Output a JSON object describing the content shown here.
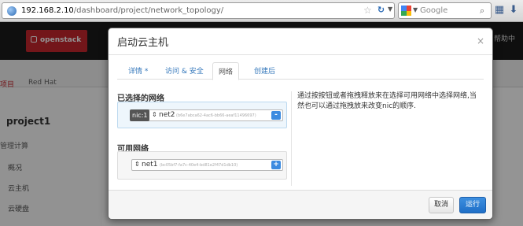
{
  "browser": {
    "url_host": "192.168.2.10",
    "url_path": "/dashboard/project/network_topology/",
    "search_placeholder": "Google"
  },
  "dashboard": {
    "logo_text": "openstack",
    "top_right": "帮助中",
    "tab_project": "项目",
    "tab_redhat": "Red Hat",
    "project_name": "project1",
    "section": "管理计算",
    "side_items": [
      "概况",
      "云主机",
      "云硬盘"
    ]
  },
  "modal": {
    "title": "启动云主机",
    "close": "×",
    "tabs": [
      "详情 *",
      "访问 & 安全",
      "网络",
      "创建后"
    ],
    "active_tab": "网络",
    "selected_title": "已选择的网络",
    "available_title": "可用网络",
    "selected_networks": [
      {
        "nic": "nic:1",
        "name": "net2",
        "id": "(b6e7abca62-4ac6-bb66-aeaf11496697)",
        "button": "-"
      }
    ],
    "available_networks": [
      {
        "name": "net1",
        "id": "(bc05bf7-fa7c-40e4-bd81e2f47d1db10)",
        "button": "+"
      }
    ],
    "help_text": "通过按按钮或者拖拽释放来在选择可用网络中选择网络,当然也可以通过拖拽放来改变nic的顺序.",
    "buttons": {
      "cancel": "取消",
      "launch": "运行"
    }
  }
}
